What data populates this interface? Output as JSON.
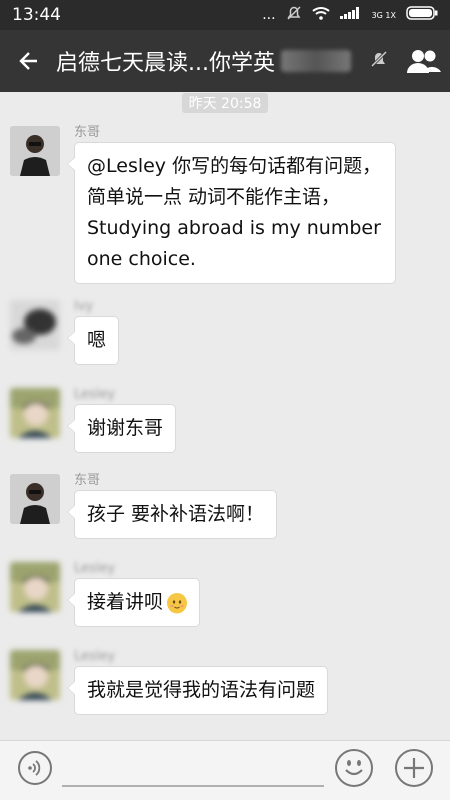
{
  "status_bar": {
    "time": "13:44",
    "dots": "...",
    "network": "3G 1X"
  },
  "chat": {
    "title_visible": "启德七天晨读...你学英",
    "back_icon": "back-arrow-icon",
    "mute_icon": "mute-bell-icon",
    "members_icon": "group-members-icon"
  },
  "timestamp": "昨天 20:58",
  "messages": [
    {
      "sender": "东哥",
      "text": "@Lesley 你写的每句话都有问题，简单说一点 动词不能作主语，Studying abroad is my number one choice."
    },
    {
      "sender": "Ivy",
      "text": "嗯"
    },
    {
      "sender": "Lesley",
      "text": "谢谢东哥"
    },
    {
      "sender": "东哥",
      "text": "孩子 要补补语法啊！"
    },
    {
      "sender": "Lesley",
      "text": "接着讲呗"
    },
    {
      "sender": "Lesley",
      "text": "我就是觉得我的语法有问题"
    }
  ],
  "input": {
    "voice_icon": "voice-icon",
    "emoji_icon": "emoji-icon",
    "plus_icon": "plus-icon"
  },
  "colors": {
    "title_bar": "#353535",
    "status_bar": "#2b2b2b",
    "chat_bg": "#ebebeb",
    "bubble": "#ffffff"
  }
}
